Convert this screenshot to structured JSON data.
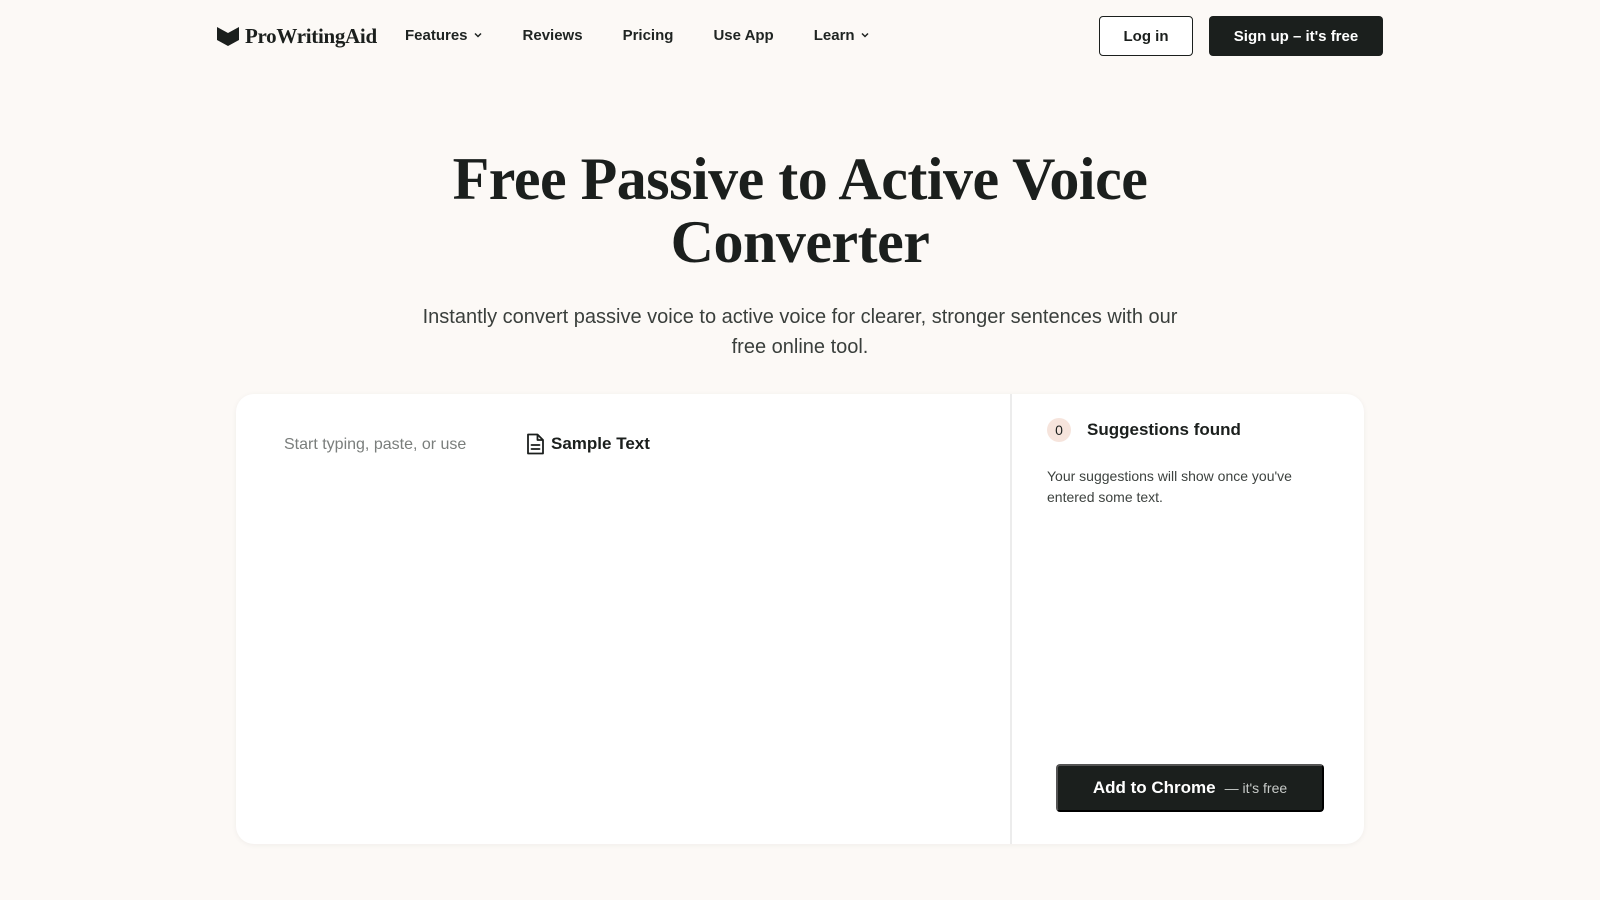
{
  "nav": {
    "logo_text": "ProWritingAid",
    "links": [
      {
        "label": "Features",
        "has_dropdown": true
      },
      {
        "label": "Reviews",
        "has_dropdown": false
      },
      {
        "label": "Pricing",
        "has_dropdown": false
      },
      {
        "label": "Use App",
        "has_dropdown": false
      },
      {
        "label": "Learn",
        "has_dropdown": true
      }
    ],
    "login_label": "Log in",
    "signup_label": "Sign up – it's free"
  },
  "hero": {
    "title_line1": "Free Passive to Active Voice",
    "title_line2": "Converter",
    "subtitle_line1": "Instantly convert passive voice to active voice for clearer, stronger sentences with our",
    "subtitle_line2": "free online tool."
  },
  "editor": {
    "placeholder": "Start typing, paste, or use",
    "sample_label": "Sample Text",
    "sample_icon": "document-icon"
  },
  "suggestions": {
    "count": "0",
    "title": "Suggestions found",
    "description": "Your suggestions will show once you've entered some text.",
    "cta_main": "Add to Chrome",
    "cta_sub": "— it's free"
  },
  "colors": {
    "page_bg": "#fcf9f6",
    "primary_dark": "#1b1f1d",
    "badge_bg": "#f6e4dc",
    "card_bg": "#ffffff"
  }
}
